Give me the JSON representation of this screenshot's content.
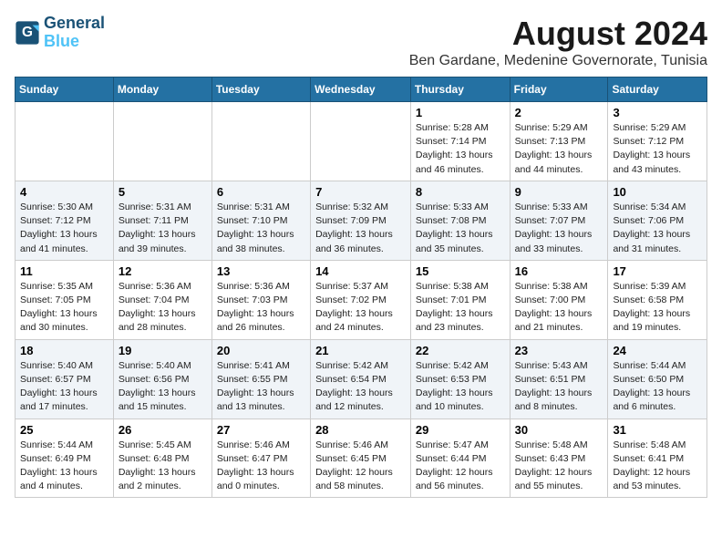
{
  "header": {
    "logo_line1": "General",
    "logo_line2": "Blue",
    "month_title": "August 2024",
    "location": "Ben Gardane, Medenine Governorate, Tunisia"
  },
  "weekdays": [
    "Sunday",
    "Monday",
    "Tuesday",
    "Wednesday",
    "Thursday",
    "Friday",
    "Saturday"
  ],
  "weeks": [
    [
      {
        "day": "",
        "detail": ""
      },
      {
        "day": "",
        "detail": ""
      },
      {
        "day": "",
        "detail": ""
      },
      {
        "day": "",
        "detail": ""
      },
      {
        "day": "1",
        "detail": "Sunrise: 5:28 AM\nSunset: 7:14 PM\nDaylight: 13 hours\nand 46 minutes."
      },
      {
        "day": "2",
        "detail": "Sunrise: 5:29 AM\nSunset: 7:13 PM\nDaylight: 13 hours\nand 44 minutes."
      },
      {
        "day": "3",
        "detail": "Sunrise: 5:29 AM\nSunset: 7:12 PM\nDaylight: 13 hours\nand 43 minutes."
      }
    ],
    [
      {
        "day": "4",
        "detail": "Sunrise: 5:30 AM\nSunset: 7:12 PM\nDaylight: 13 hours\nand 41 minutes."
      },
      {
        "day": "5",
        "detail": "Sunrise: 5:31 AM\nSunset: 7:11 PM\nDaylight: 13 hours\nand 39 minutes."
      },
      {
        "day": "6",
        "detail": "Sunrise: 5:31 AM\nSunset: 7:10 PM\nDaylight: 13 hours\nand 38 minutes."
      },
      {
        "day": "7",
        "detail": "Sunrise: 5:32 AM\nSunset: 7:09 PM\nDaylight: 13 hours\nand 36 minutes."
      },
      {
        "day": "8",
        "detail": "Sunrise: 5:33 AM\nSunset: 7:08 PM\nDaylight: 13 hours\nand 35 minutes."
      },
      {
        "day": "9",
        "detail": "Sunrise: 5:33 AM\nSunset: 7:07 PM\nDaylight: 13 hours\nand 33 minutes."
      },
      {
        "day": "10",
        "detail": "Sunrise: 5:34 AM\nSunset: 7:06 PM\nDaylight: 13 hours\nand 31 minutes."
      }
    ],
    [
      {
        "day": "11",
        "detail": "Sunrise: 5:35 AM\nSunset: 7:05 PM\nDaylight: 13 hours\nand 30 minutes."
      },
      {
        "day": "12",
        "detail": "Sunrise: 5:36 AM\nSunset: 7:04 PM\nDaylight: 13 hours\nand 28 minutes."
      },
      {
        "day": "13",
        "detail": "Sunrise: 5:36 AM\nSunset: 7:03 PM\nDaylight: 13 hours\nand 26 minutes."
      },
      {
        "day": "14",
        "detail": "Sunrise: 5:37 AM\nSunset: 7:02 PM\nDaylight: 13 hours\nand 24 minutes."
      },
      {
        "day": "15",
        "detail": "Sunrise: 5:38 AM\nSunset: 7:01 PM\nDaylight: 13 hours\nand 23 minutes."
      },
      {
        "day": "16",
        "detail": "Sunrise: 5:38 AM\nSunset: 7:00 PM\nDaylight: 13 hours\nand 21 minutes."
      },
      {
        "day": "17",
        "detail": "Sunrise: 5:39 AM\nSunset: 6:58 PM\nDaylight: 13 hours\nand 19 minutes."
      }
    ],
    [
      {
        "day": "18",
        "detail": "Sunrise: 5:40 AM\nSunset: 6:57 PM\nDaylight: 13 hours\nand 17 minutes."
      },
      {
        "day": "19",
        "detail": "Sunrise: 5:40 AM\nSunset: 6:56 PM\nDaylight: 13 hours\nand 15 minutes."
      },
      {
        "day": "20",
        "detail": "Sunrise: 5:41 AM\nSunset: 6:55 PM\nDaylight: 13 hours\nand 13 minutes."
      },
      {
        "day": "21",
        "detail": "Sunrise: 5:42 AM\nSunset: 6:54 PM\nDaylight: 13 hours\nand 12 minutes."
      },
      {
        "day": "22",
        "detail": "Sunrise: 5:42 AM\nSunset: 6:53 PM\nDaylight: 13 hours\nand 10 minutes."
      },
      {
        "day": "23",
        "detail": "Sunrise: 5:43 AM\nSunset: 6:51 PM\nDaylight: 13 hours\nand 8 minutes."
      },
      {
        "day": "24",
        "detail": "Sunrise: 5:44 AM\nSunset: 6:50 PM\nDaylight: 13 hours\nand 6 minutes."
      }
    ],
    [
      {
        "day": "25",
        "detail": "Sunrise: 5:44 AM\nSunset: 6:49 PM\nDaylight: 13 hours\nand 4 minutes."
      },
      {
        "day": "26",
        "detail": "Sunrise: 5:45 AM\nSunset: 6:48 PM\nDaylight: 13 hours\nand 2 minutes."
      },
      {
        "day": "27",
        "detail": "Sunrise: 5:46 AM\nSunset: 6:47 PM\nDaylight: 13 hours\nand 0 minutes."
      },
      {
        "day": "28",
        "detail": "Sunrise: 5:46 AM\nSunset: 6:45 PM\nDaylight: 12 hours\nand 58 minutes."
      },
      {
        "day": "29",
        "detail": "Sunrise: 5:47 AM\nSunset: 6:44 PM\nDaylight: 12 hours\nand 56 minutes."
      },
      {
        "day": "30",
        "detail": "Sunrise: 5:48 AM\nSunset: 6:43 PM\nDaylight: 12 hours\nand 55 minutes."
      },
      {
        "day": "31",
        "detail": "Sunrise: 5:48 AM\nSunset: 6:41 PM\nDaylight: 12 hours\nand 53 minutes."
      }
    ]
  ]
}
